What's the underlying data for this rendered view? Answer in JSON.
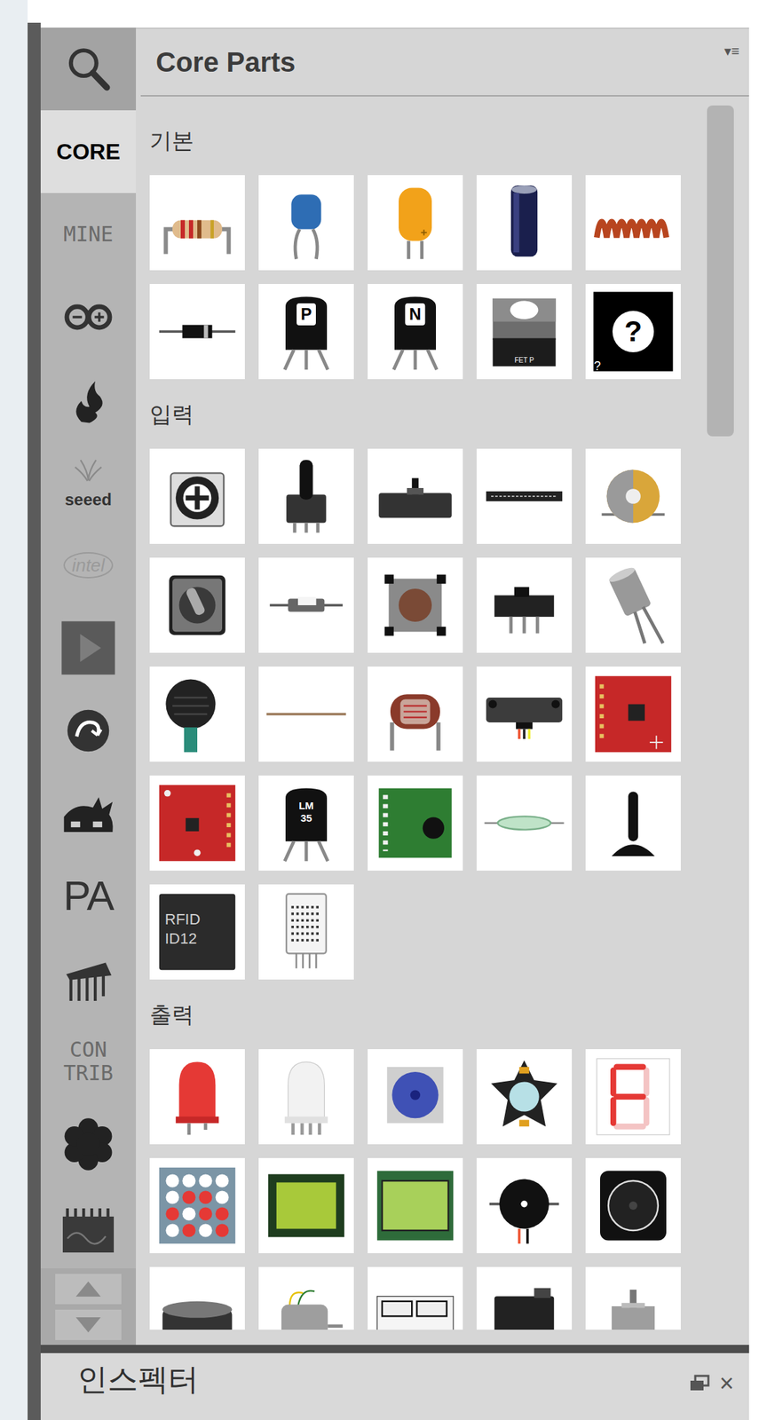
{
  "tabs": [
    {
      "kind": "search",
      "selected": false
    },
    {
      "kind": "text",
      "label": "CORE",
      "selected": true
    },
    {
      "kind": "text",
      "label": "MINE",
      "selected": false
    },
    {
      "kind": "arduino",
      "selected": false
    },
    {
      "kind": "sparkfun",
      "selected": false
    },
    {
      "kind": "seeed",
      "label": "seeed",
      "selected": false
    },
    {
      "kind": "intel",
      "label": "intel",
      "selected": false
    },
    {
      "kind": "play",
      "selected": false
    },
    {
      "kind": "circle",
      "selected": false
    },
    {
      "kind": "animals",
      "selected": false
    },
    {
      "kind": "logo",
      "label": "PA",
      "selected": false
    },
    {
      "kind": "piano",
      "selected": false
    },
    {
      "kind": "text",
      "label": "CON TRIB",
      "selected": false
    },
    {
      "kind": "flower",
      "selected": false
    },
    {
      "kind": "chip",
      "selected": false
    }
  ],
  "panel": {
    "title": "Core Parts",
    "menu_icon": "▾≡"
  },
  "sections": [
    {
      "title": "기본",
      "parts": [
        {
          "kind": "resistor"
        },
        {
          "kind": "ceramic"
        },
        {
          "kind": "tantalum"
        },
        {
          "kind": "electrolytic"
        },
        {
          "kind": "inductor"
        },
        {
          "kind": "diode"
        },
        {
          "kind": "pnp",
          "labels": [
            "P"
          ]
        },
        {
          "kind": "npn",
          "labels": [
            "N"
          ]
        },
        {
          "kind": "mosfet",
          "labels": [
            "FET P"
          ]
        },
        {
          "kind": "mystery",
          "labels": [
            "?",
            "?"
          ]
        }
      ]
    },
    {
      "title": "입력",
      "parts": [
        {
          "kind": "trimmer"
        },
        {
          "kind": "rotpot"
        },
        {
          "kind": "slidepot"
        },
        {
          "kind": "chipstrip"
        },
        {
          "kind": "piezo"
        },
        {
          "kind": "encoder"
        },
        {
          "kind": "smallswitch"
        },
        {
          "kind": "pushbutton"
        },
        {
          "kind": "slideswitch"
        },
        {
          "kind": "tiltsensor"
        },
        {
          "kind": "fsr"
        },
        {
          "kind": "flex"
        },
        {
          "kind": "photocell"
        },
        {
          "kind": "irsensor"
        },
        {
          "kind": "accelboard"
        },
        {
          "kind": "redboard"
        },
        {
          "kind": "lm35",
          "labels": [
            "LM",
            "35"
          ]
        },
        {
          "kind": "greenboard"
        },
        {
          "kind": "reed"
        },
        {
          "kind": "stand"
        },
        {
          "kind": "rfid",
          "labels": [
            "RFID",
            "ID12"
          ]
        },
        {
          "kind": "dht"
        }
      ]
    },
    {
      "title": "출력",
      "parts": [
        {
          "kind": "redled"
        },
        {
          "kind": "rgbled"
        },
        {
          "kind": "blueled"
        },
        {
          "kind": "starled"
        },
        {
          "kind": "sevenseg"
        },
        {
          "kind": "matrix"
        },
        {
          "kind": "lcd1"
        },
        {
          "kind": "lcd2"
        },
        {
          "kind": "buzzer"
        },
        {
          "kind": "speaker"
        },
        {
          "kind": "ring"
        },
        {
          "kind": "dcmotor"
        },
        {
          "kind": "driver"
        },
        {
          "kind": "servo"
        },
        {
          "kind": "stepper"
        }
      ]
    }
  ],
  "inspector": {
    "title": "인스펙터",
    "close": "×"
  }
}
